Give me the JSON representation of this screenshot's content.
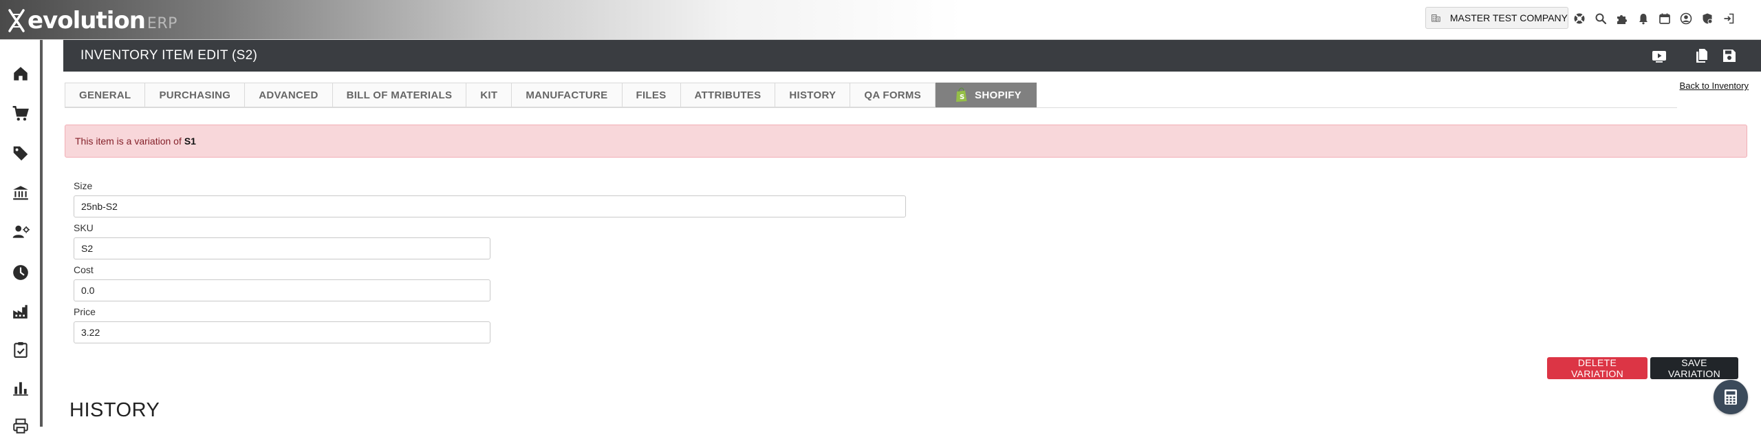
{
  "brand": {
    "name": "evolution",
    "suffix": "ERP"
  },
  "topbar": {
    "company": "MASTER TEST COMPANY",
    "icons": [
      "support-icon",
      "search-icon",
      "puzzle-icon",
      "bell-icon",
      "calendar-icon",
      "user-icon",
      "security-icon",
      "logout-icon"
    ]
  },
  "sidebar": {
    "items": [
      "home-icon",
      "cart-icon",
      "tag-icon",
      "bank-icon",
      "user-manage-icon",
      "clock-icon",
      "factory-icon",
      "checklist-icon",
      "bar-chart-icon",
      "printer-icon"
    ]
  },
  "header": {
    "title": "INVENTORY ITEM EDIT (S2)",
    "icons": [
      "video-icon",
      "copy-icon",
      "save-icon"
    ]
  },
  "tabs": [
    {
      "label": "GENERAL"
    },
    {
      "label": "PURCHASING"
    },
    {
      "label": "ADVANCED"
    },
    {
      "label": "BILL OF MATERIALS"
    },
    {
      "label": "KIT"
    },
    {
      "label": "MANUFACTURE"
    },
    {
      "label": "FILES"
    },
    {
      "label": "ATTRIBUTES"
    },
    {
      "label": "HISTORY"
    },
    {
      "label": "QA FORMS"
    },
    {
      "label": "SHOPIFY",
      "active": true
    }
  ],
  "back_link": "Back to Inventory",
  "alert": {
    "text": "This item is a variation of",
    "item": "S1"
  },
  "form": {
    "size": {
      "label": "Size",
      "value": "25nb-S2"
    },
    "sku": {
      "label": "SKU",
      "value": "S2"
    },
    "cost": {
      "label": "Cost",
      "value": "0.0"
    },
    "price": {
      "label": "Price",
      "value": "3.22"
    }
  },
  "buttons": {
    "delete": "DELETE VARIATION",
    "save": "SAVE VARIATION"
  },
  "history_title": "HISTORY",
  "colors": {
    "header_bg": "#3a3d41",
    "alert_bg": "#f8d7da",
    "delete": "#dc3545",
    "save": "#212529",
    "tab_active": "#808080"
  }
}
